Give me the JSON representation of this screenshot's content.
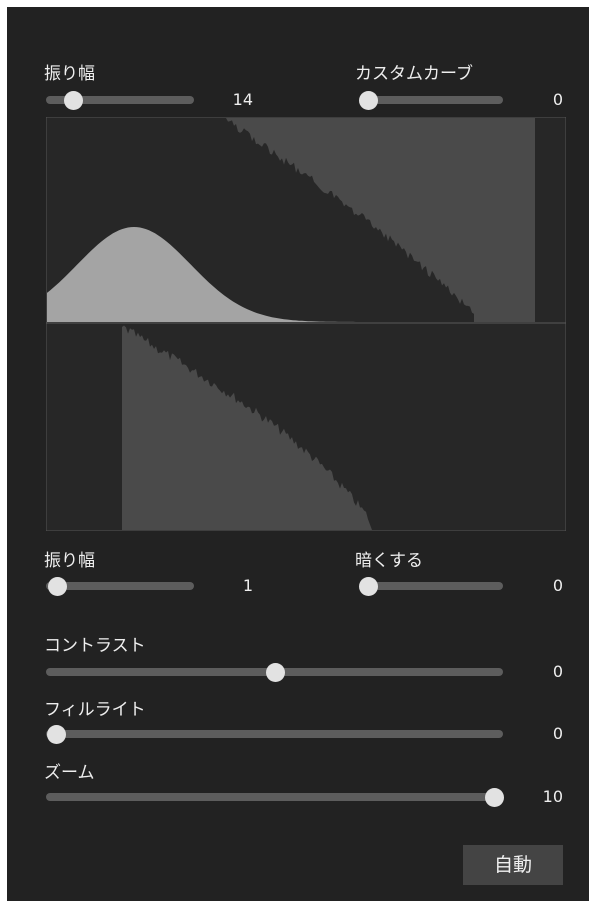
{
  "top": {
    "amplitude": {
      "label": "振り幅",
      "value": "14",
      "level": 0.14
    },
    "custom_curve": {
      "label": "カスタムカーブ",
      "value": "0",
      "level": 0.0
    }
  },
  "bottom": {
    "amplitude": {
      "label": "振り幅",
      "value": "1",
      "level": 0.01
    },
    "darken": {
      "label": "暗くする",
      "value": "0",
      "level": 0.0
    }
  },
  "contrast": {
    "label": "コントラスト",
    "value": "0",
    "level": 0.5
  },
  "fill_light": {
    "label": "フィルライト",
    "value": "0",
    "level": 0.0
  },
  "zoom": {
    "label": "ズーム",
    "value": "10",
    "level": 1.0
  },
  "auto_label": "自動",
  "colors": {
    "panel": "#222222",
    "graph_background": "#272727",
    "histogram_fill": "#4a4a4a",
    "curve_fill": "#a4a4a4",
    "track": "#5d5d5d",
    "thumb": "#e2e2e2",
    "button": "#444444"
  }
}
